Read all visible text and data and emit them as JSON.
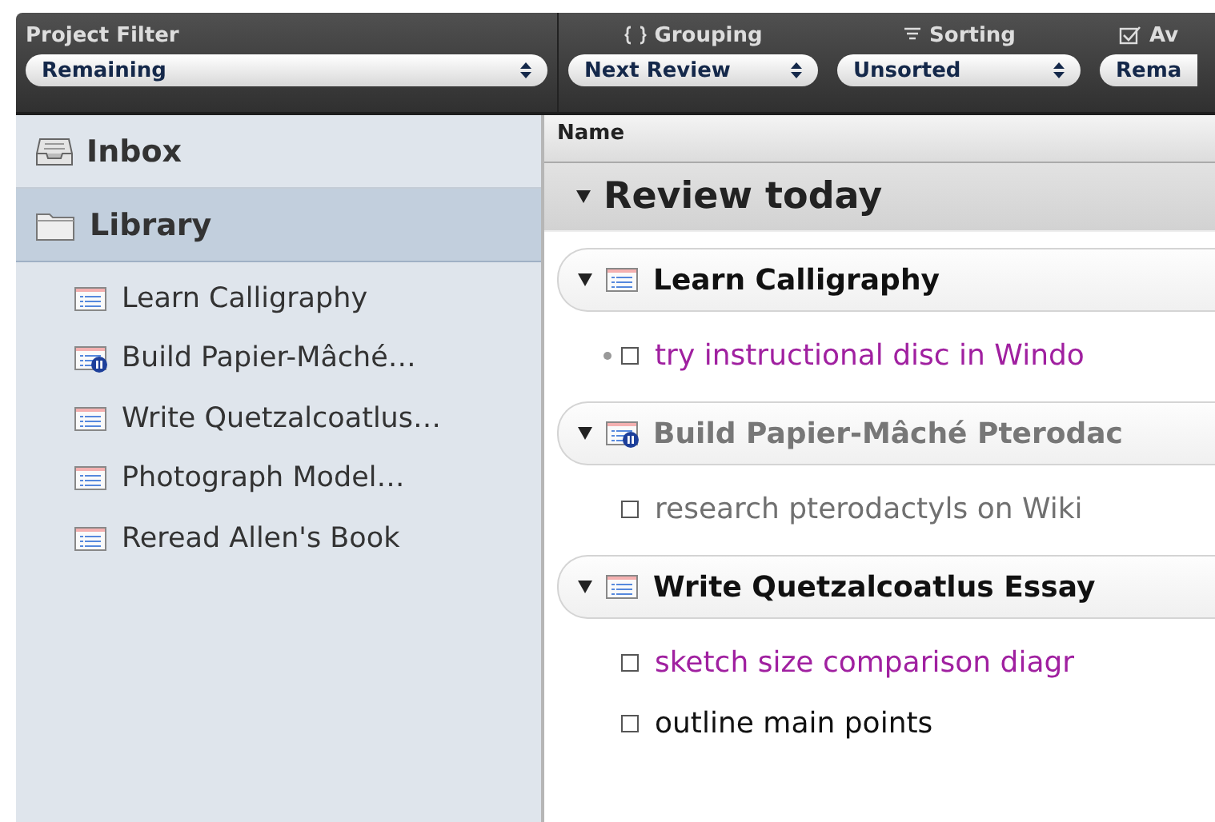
{
  "toolbar": [
    {
      "kind": "filter",
      "label": "Project Filter",
      "value": "Remaining"
    },
    {
      "kind": "grouping",
      "label": "Grouping",
      "value": "Next Review"
    },
    {
      "kind": "sorting",
      "label": "Sorting",
      "value": "Unsorted"
    },
    {
      "kind": "availability",
      "label": "Av",
      "value": "Rema"
    }
  ],
  "sidebar": {
    "items": [
      {
        "kind": "inbox",
        "label": "Inbox",
        "selected": false
      },
      {
        "kind": "library",
        "label": "Library",
        "selected": true,
        "children": [
          {
            "label": "Learn Calligraphy",
            "on_hold": false
          },
          {
            "label": "Build Papier-Mâché…",
            "on_hold": true
          },
          {
            "label": "Write Quetzalcoatlus…",
            "on_hold": false
          },
          {
            "label": "Photograph Model…",
            "on_hold": false
          },
          {
            "label": "Reread Allen's Book",
            "on_hold": false
          }
        ]
      }
    ]
  },
  "outline": {
    "column": "Name",
    "groups": [
      {
        "title": "Review today",
        "expanded": true,
        "projects": [
          {
            "title": "Learn Calligraphy",
            "on_hold": false,
            "expanded": true,
            "tasks": [
              {
                "title": "try instructional disc in Windo",
                "color": "#a020a0",
                "checked": false,
                "has_note": true
              }
            ]
          },
          {
            "title": "Build Papier-Mâché Pterodac",
            "on_hold": true,
            "expanded": true,
            "tasks": [
              {
                "title": "research pterodactyls on Wiki",
                "color": "#707070",
                "checked": false,
                "has_note": false
              }
            ]
          },
          {
            "title": "Write Quetzalcoatlus Essay",
            "on_hold": false,
            "expanded": true,
            "tasks": [
              {
                "title": "sketch size comparison diagr",
                "color": "#a020a0",
                "checked": false,
                "has_note": false
              },
              {
                "title": "outline main points",
                "color": "#111111",
                "checked": false,
                "has_note": false
              }
            ]
          }
        ]
      }
    ]
  }
}
